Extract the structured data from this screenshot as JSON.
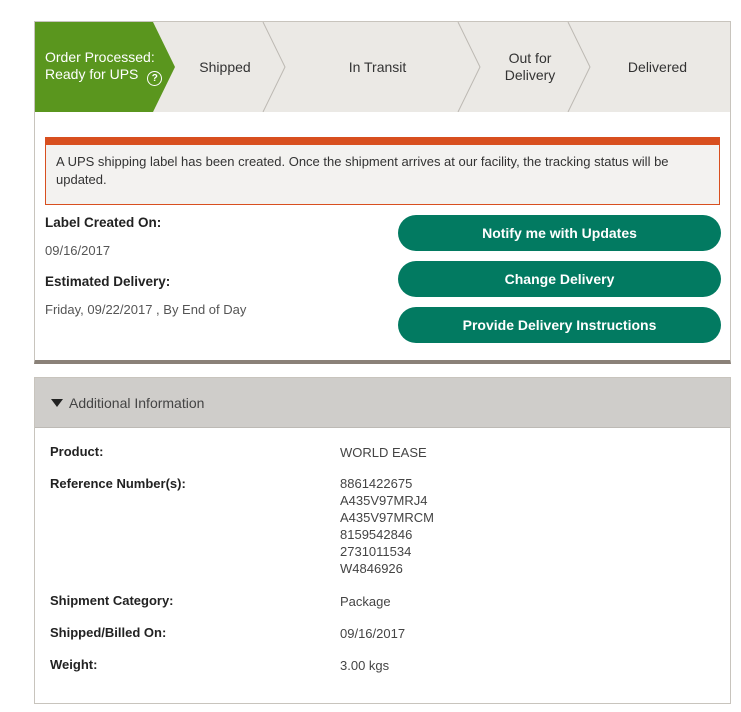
{
  "progress": {
    "steps": [
      {
        "line1": "Order Processed:",
        "line2": "Ready for UPS"
      },
      {
        "line1": "Shipped",
        "line2": ""
      },
      {
        "line1": "In Transit",
        "line2": ""
      },
      {
        "line1": "Out for",
        "line2": "Delivery"
      },
      {
        "line1": "Delivered",
        "line2": ""
      }
    ],
    "active_color": "#5a961e",
    "inactive_color": "#ebe9e5"
  },
  "alert": {
    "text": "A UPS shipping label has been created. Once the shipment arrives at our facility, the tracking status will be updated.",
    "accent_color": "#d84f1f"
  },
  "summary": {
    "label_created_label": "Label Created On:",
    "label_created_value": "09/16/2017",
    "estimated_delivery_label": "Estimated Delivery:",
    "estimated_delivery_value": "Friday, 09/22/2017 , By End of Day"
  },
  "actions": {
    "notify": "Notify me with Updates",
    "change": "Change Delivery",
    "instructions": "Provide Delivery Instructions",
    "button_color": "#027a61"
  },
  "additional": {
    "header": "Additional Information",
    "product_label": "Product:",
    "product_value": "WORLD EASE",
    "reference_label": "Reference Number(s):",
    "references": [
      "8861422675",
      "A435V97MRJ4",
      "A435V97MRCM",
      "8159542846",
      "2731011534",
      "W4846926"
    ],
    "category_label": "Shipment Category:",
    "category_value": "Package",
    "shipped_label": "Shipped/Billed On:",
    "shipped_value": "09/16/2017",
    "weight_label": "Weight:",
    "weight_value": "3.00 kgs"
  }
}
